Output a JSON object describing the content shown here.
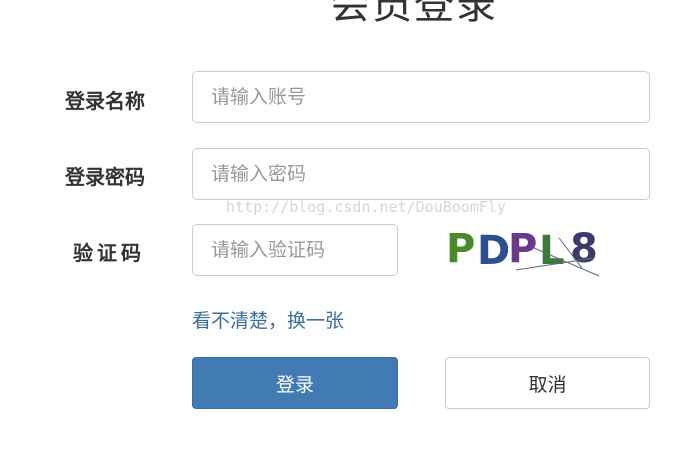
{
  "page": {
    "title": "会员登录",
    "watermark": "http://blog.csdn.net/DouBoomFly"
  },
  "form": {
    "username": {
      "label": "登录名称",
      "placeholder": "请输入账号",
      "value": ""
    },
    "password": {
      "label": "登录密码",
      "placeholder": "请输入密码",
      "value": ""
    },
    "captcha": {
      "label": "验证码",
      "placeholder": "请输入验证码",
      "value": ""
    },
    "captcha_image": {
      "text": "PDPL8",
      "colors": [
        "#4a8a2a",
        "#2d4f8f",
        "#6a3a8a",
        "#3a7a3a",
        "#3b3b6b"
      ]
    },
    "refresh_link": "看不清楚，换一张"
  },
  "buttons": {
    "login": "登录",
    "cancel": "取消"
  },
  "colors": {
    "primary": "#427ab4",
    "link": "#3a6e9f",
    "border": "#cccccc",
    "text": "#333333"
  }
}
